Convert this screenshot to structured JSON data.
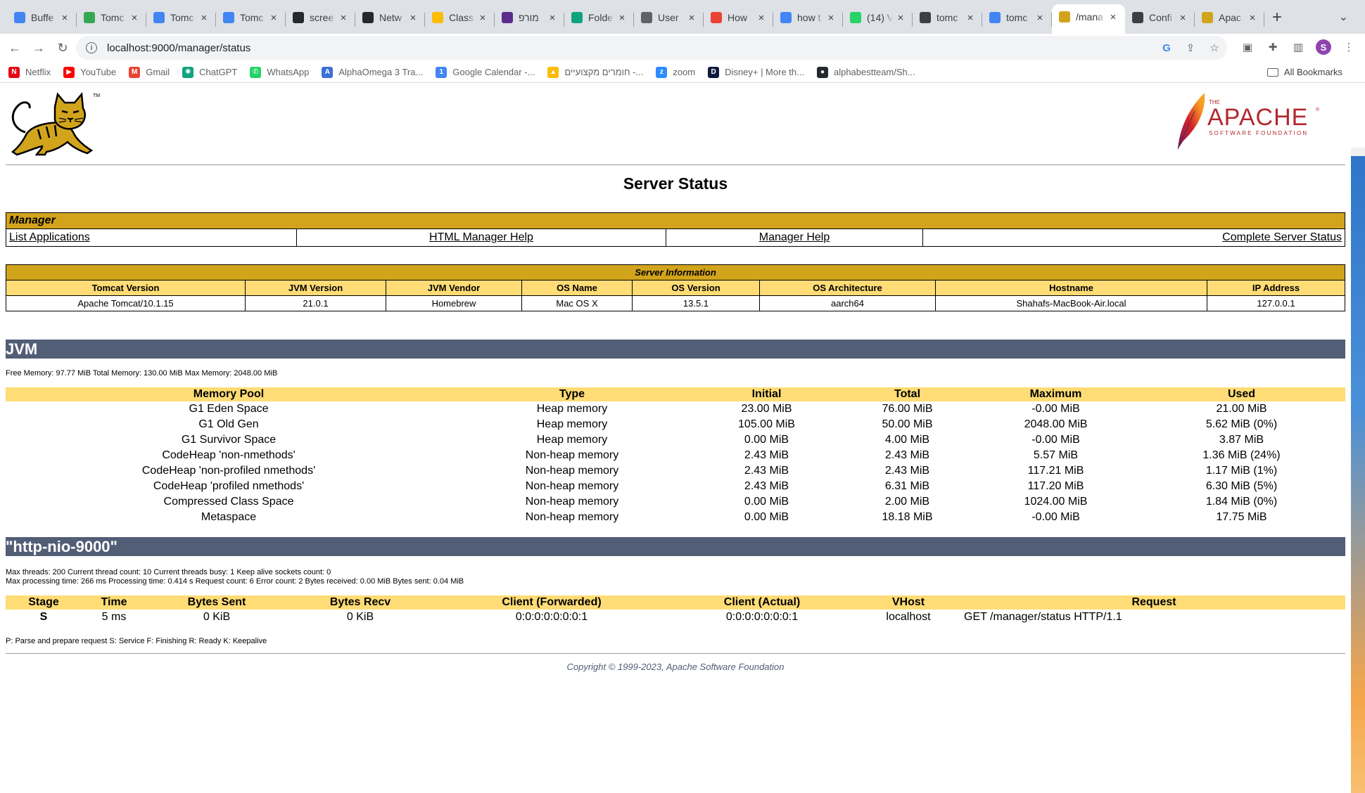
{
  "browser": {
    "tabs": [
      {
        "title": "Buffe",
        "favicon_color": "#4285f4",
        "favicon": "docs-icon"
      },
      {
        "title": "Tomc",
        "favicon_color": "#34a853",
        "favicon": "drive-icon"
      },
      {
        "title": "Tomc",
        "favicon_color": "#4285f4",
        "favicon": "docs-icon"
      },
      {
        "title": "Tomc",
        "favicon_color": "#4285f4",
        "favicon": "docs-icon"
      },
      {
        "title": "scree",
        "favicon_color": "#24292f",
        "favicon": "github-icon"
      },
      {
        "title": "Netw",
        "favicon_color": "#24292f",
        "favicon": "github-icon"
      },
      {
        "title": "Class",
        "favicon_color": "#fbbc04",
        "favicon": "classroom-icon"
      },
      {
        "title": "מורפ",
        "favicon_color": "#5b2d8e",
        "favicon": "d-icon"
      },
      {
        "title": "Folde",
        "favicon_color": "#10a37f",
        "favicon": "chatgpt-icon"
      },
      {
        "title": "User",
        "favicon_color": "#5f6368",
        "favicon": "globe-icon"
      },
      {
        "title": "How",
        "favicon_color": "#ea4335",
        "favicon": "help-icon"
      },
      {
        "title": "how t",
        "favicon_color": "#4285f4",
        "favicon": "google-icon"
      },
      {
        "title": "(14) V",
        "favicon_color": "#25d366",
        "favicon": "whatsapp-icon"
      },
      {
        "title": "tomc",
        "favicon_color": "#3c4043",
        "favicon": "openai-icon"
      },
      {
        "title": "tomc",
        "favicon_color": "#4285f4",
        "favicon": "google-icon"
      },
      {
        "title": "/mana",
        "favicon_color": "#d2a41c",
        "favicon": "tomcat-icon",
        "active": true
      },
      {
        "title": "Confi",
        "favicon_color": "#3c4043",
        "favicon": "settings-icon"
      },
      {
        "title": "Apac",
        "favicon_color": "#d2a41c",
        "favicon": "tomcat-icon"
      }
    ],
    "url": "localhost:9000/manager/status",
    "profile_initial": "S",
    "bookmarks": [
      {
        "label": "Netflix",
        "color": "#e50914",
        "letter": "N"
      },
      {
        "label": "YouTube",
        "color": "#ff0000",
        "letter": "▶"
      },
      {
        "label": "Gmail",
        "color": "#ea4335",
        "letter": "M"
      },
      {
        "label": "ChatGPT",
        "color": "#10a37f",
        "letter": "✺"
      },
      {
        "label": "WhatsApp",
        "color": "#25d366",
        "letter": "✆"
      },
      {
        "label": "AlphaOmega 3 Tra...",
        "color": "#3b6fd4",
        "letter": "A"
      },
      {
        "label": "Google Calendar -...",
        "color": "#4285f4",
        "letter": "1"
      },
      {
        "label": "חומרים מקצועיים -...",
        "color": "#fbbc04",
        "letter": "▲"
      },
      {
        "label": "zoom",
        "color": "#2d8cff",
        "letter": "z"
      },
      {
        "label": "Disney+ | More th...",
        "color": "#0e1a3c",
        "letter": "D"
      },
      {
        "label": "alphabestteam/Sh...",
        "color": "#24292f",
        "letter": "●"
      }
    ],
    "all_bookmarks_label": "All Bookmarks"
  },
  "page": {
    "title": "Server Status",
    "manager": {
      "header": "Manager",
      "links": [
        "List Applications",
        "HTML Manager Help",
        "Manager Help",
        "Complete Server Status"
      ]
    },
    "server_info": {
      "header": "Server Information",
      "columns": [
        "Tomcat Version",
        "JVM Version",
        "JVM Vendor",
        "OS Name",
        "OS Version",
        "OS Architecture",
        "Hostname",
        "IP Address"
      ],
      "values": [
        "Apache Tomcat/10.1.15",
        "21.0.1",
        "Homebrew",
        "Mac OS X",
        "13.5.1",
        "aarch64",
        "Shahafs-MacBook-Air.local",
        "127.0.0.1"
      ]
    },
    "jvm": {
      "header": "JVM",
      "memory_summary": "Free Memory: 97.77 MiB Total Memory: 130.00 MiB Max Memory: 2048.00 MiB",
      "columns": [
        "Memory Pool",
        "Type",
        "Initial",
        "Total",
        "Maximum",
        "Used"
      ],
      "rows": [
        [
          "G1 Eden Space",
          "Heap memory",
          "23.00 MiB",
          "76.00 MiB",
          "-0.00 MiB",
          "21.00 MiB"
        ],
        [
          "G1 Old Gen",
          "Heap memory",
          "105.00 MiB",
          "50.00 MiB",
          "2048.00 MiB",
          "5.62 MiB (0%)"
        ],
        [
          "G1 Survivor Space",
          "Heap memory",
          "0.00 MiB",
          "4.00 MiB",
          "-0.00 MiB",
          "3.87 MiB"
        ],
        [
          "CodeHeap 'non-nmethods'",
          "Non-heap memory",
          "2.43 MiB",
          "2.43 MiB",
          "5.57 MiB",
          "1.36 MiB (24%)"
        ],
        [
          "CodeHeap 'non-profiled nmethods'",
          "Non-heap memory",
          "2.43 MiB",
          "2.43 MiB",
          "117.21 MiB",
          "1.17 MiB (1%)"
        ],
        [
          "CodeHeap 'profiled nmethods'",
          "Non-heap memory",
          "2.43 MiB",
          "6.31 MiB",
          "117.20 MiB",
          "6.30 MiB (5%)"
        ],
        [
          "Compressed Class Space",
          "Non-heap memory",
          "0.00 MiB",
          "2.00 MiB",
          "1024.00 MiB",
          "1.84 MiB (0%)"
        ],
        [
          "Metaspace",
          "Non-heap memory",
          "0.00 MiB",
          "18.18 MiB",
          "-0.00 MiB",
          "17.75 MiB"
        ]
      ]
    },
    "connector": {
      "header": "\"http-nio-9000\"",
      "line1": "Max threads: 200 Current thread count: 10 Current threads busy: 1 Keep alive sockets count: 0",
      "line2": "Max processing time: 266 ms Processing time: 0.414 s Request count: 6 Error count: 2 Bytes received: 0.00 MiB Bytes sent: 0.04 MiB",
      "columns": [
        "Stage",
        "Time",
        "Bytes Sent",
        "Bytes Recv",
        "Client (Forwarded)",
        "Client (Actual)",
        "VHost",
        "Request"
      ],
      "rows": [
        [
          "S",
          "5 ms",
          "0 KiB",
          "0 KiB",
          "0:0:0:0:0:0:0:1",
          "0:0:0:0:0:0:0:1",
          "localhost",
          "GET /manager/status HTTP/1.1"
        ]
      ],
      "legend": "P: Parse and prepare request S: Service F: Finishing R: Ready K: Keepalive"
    },
    "copyright": "Copyright © 1999-2023, Apache Software Foundation",
    "apache_logo": {
      "the": "THE",
      "name": "APACHE",
      "tm": "®",
      "sub": "SOFTWARE FOUNDATION"
    },
    "tomcat_logo": {
      "tm": "TM"
    },
    "colors": {
      "manager_header": "#D2A41C",
      "table_header": "#FFDC75",
      "section_bar": "#525D76"
    }
  }
}
